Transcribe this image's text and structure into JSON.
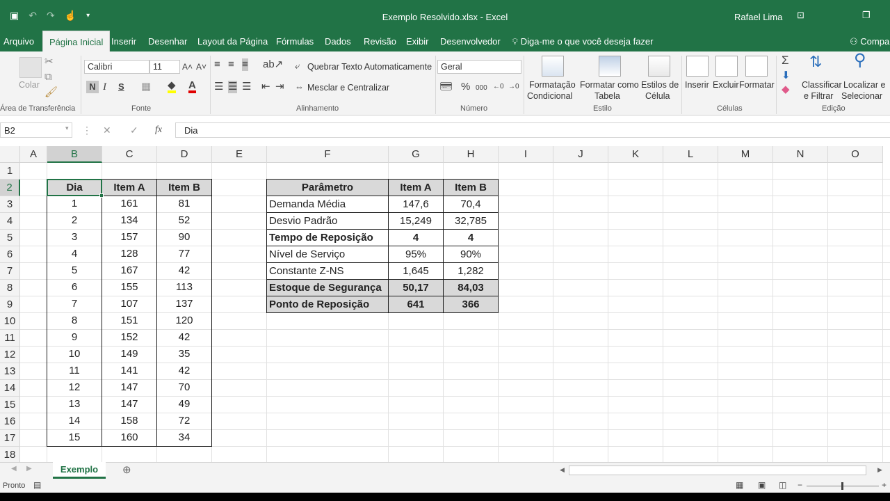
{
  "window": {
    "title": "Exemplo Resolvido.xlsx - Excel",
    "user": "Rafael Lima"
  },
  "tabs": {
    "file": "Arquivo",
    "items": [
      "Página Inicial",
      "Inserir",
      "Desenhar",
      "Layout da Página",
      "Fórmulas",
      "Dados",
      "Revisão",
      "Exibir",
      "Desenvolvedor"
    ],
    "tell_me": "Diga-me o que você deseja fazer",
    "share": "Compa"
  },
  "ribbon": {
    "clipboard": {
      "paste": "Colar",
      "label": "Área de Transferência"
    },
    "font": {
      "name": "Calibri",
      "size": "11",
      "bold": "N",
      "italic": "I",
      "underline": "S",
      "label": "Fonte"
    },
    "alignment": {
      "wrap": "Quebrar Texto Automaticamente",
      "merge": "Mesclar e Centralizar",
      "label": "Alinhamento"
    },
    "number": {
      "format": "Geral",
      "percent": "%",
      "thousands": "000",
      "label": "Número"
    },
    "styles": {
      "conditional": [
        "Formatação",
        "Condicional"
      ],
      "table": [
        "Formatar como",
        "Tabela"
      ],
      "cell": [
        "Estilos de",
        "Célula"
      ],
      "label": "Estilo"
    },
    "cells": {
      "insert": "Inserir",
      "delete": "Excluir",
      "format": "Formatar",
      "label": "Células"
    },
    "editing": {
      "sort": [
        "Classificar",
        "e Filtrar"
      ],
      "find": [
        "Localizar e",
        "Selecionar"
      ],
      "label": "Edição",
      "sigma": "Σ"
    }
  },
  "formula_bar": {
    "name_box": "B2",
    "fx": "fx",
    "content": "Dia"
  },
  "grid": {
    "columns": [
      "A",
      "B",
      "C",
      "D",
      "E",
      "F",
      "G",
      "H",
      "I",
      "J",
      "K",
      "L",
      "M",
      "N",
      "O"
    ],
    "rows": [
      "1",
      "2",
      "3",
      "4",
      "5",
      "6",
      "7",
      "8",
      "9",
      "10",
      "11",
      "12",
      "13",
      "14",
      "15",
      "16",
      "17",
      "18"
    ],
    "table1": {
      "headers": [
        "Dia",
        "Item A",
        "Item B"
      ],
      "rows": [
        [
          "1",
          "161",
          "81"
        ],
        [
          "2",
          "134",
          "52"
        ],
        [
          "3",
          "157",
          "90"
        ],
        [
          "4",
          "128",
          "77"
        ],
        [
          "5",
          "167",
          "42"
        ],
        [
          "6",
          "155",
          "113"
        ],
        [
          "7",
          "107",
          "137"
        ],
        [
          "8",
          "151",
          "120"
        ],
        [
          "9",
          "152",
          "42"
        ],
        [
          "10",
          "149",
          "35"
        ],
        [
          "11",
          "141",
          "42"
        ],
        [
          "12",
          "147",
          "70"
        ],
        [
          "13",
          "147",
          "49"
        ],
        [
          "14",
          "158",
          "72"
        ],
        [
          "15",
          "160",
          "34"
        ]
      ]
    },
    "table2": {
      "headers": [
        "Parâmetro",
        "Item A",
        "Item B"
      ],
      "rows": [
        {
          "label": "Demanda Média",
          "a": "147,6",
          "b": "70,4",
          "bold": false,
          "fill": false
        },
        {
          "label": "Desvio Padrão",
          "a": "15,249",
          "b": "32,785",
          "bold": false,
          "fill": false
        },
        {
          "label": "Tempo de Reposição",
          "a": "4",
          "b": "4",
          "bold": true,
          "fill": false
        },
        {
          "label": "Nível de Serviço",
          "a": "95%",
          "b": "90%",
          "bold": false,
          "fill": false
        },
        {
          "label": "Constante Z-NS",
          "a": "1,645",
          "b": "1,282",
          "bold": false,
          "fill": false
        },
        {
          "label": "Estoque de Segurança",
          "a": "50,17",
          "b": "84,03",
          "bold": true,
          "fill": true
        },
        {
          "label": "Ponto de Reposição",
          "a": "641",
          "b": "366",
          "bold": true,
          "fill": true
        }
      ]
    }
  },
  "sheets": {
    "active": "Exemplo",
    "add": "⊕"
  },
  "status": {
    "text": "Pronto"
  },
  "colors": {
    "excel_green": "#217346",
    "header_fill": "#d9d9d9"
  }
}
